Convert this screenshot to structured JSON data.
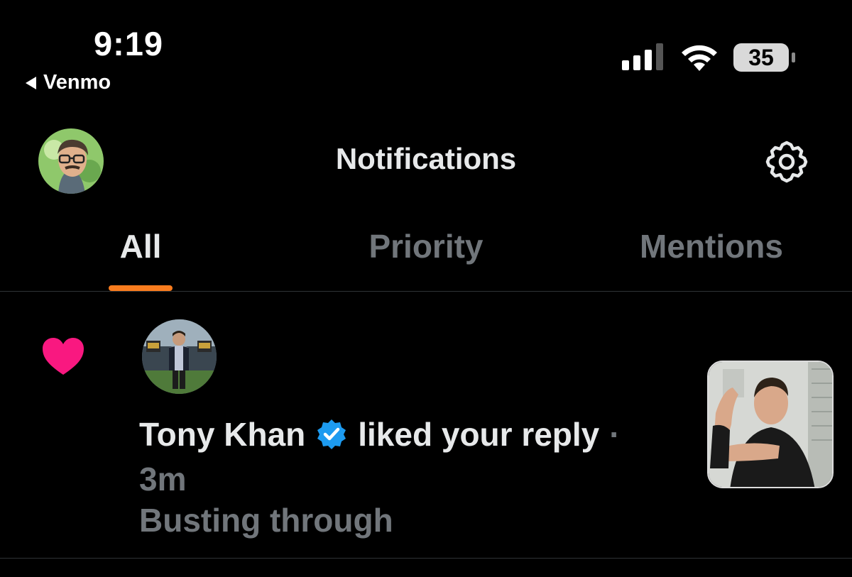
{
  "status_bar": {
    "time": "9:19",
    "back_app": "Venmo",
    "battery_level": "35",
    "signal_bars_active": 3,
    "signal_bars_total": 4
  },
  "header": {
    "title": "Notifications",
    "left_icon": "profile-avatar",
    "right_icon": "gear-icon"
  },
  "tabs": [
    {
      "label": "All",
      "active": true
    },
    {
      "label": "Priority",
      "active": false
    },
    {
      "label": "Mentions",
      "active": false
    }
  ],
  "accent_color": "#f97c1e",
  "notification": {
    "type_icon": "heart-icon",
    "icon_color": "#f91880",
    "user_name": "Tony Khan",
    "verified": true,
    "action": "liked your reply",
    "separator": "·",
    "time_ago": "3m",
    "snippet": "Busting through"
  }
}
